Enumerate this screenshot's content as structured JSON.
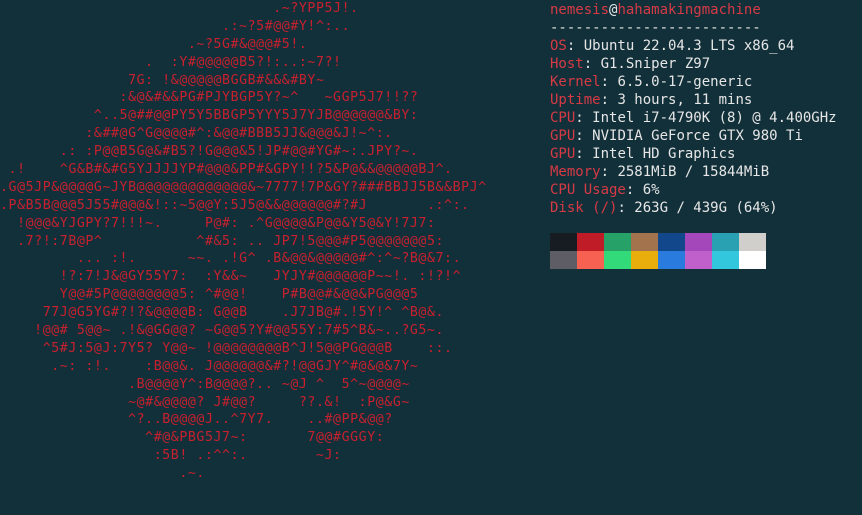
{
  "colors": {
    "background": "#12303a",
    "accent": "#c8202e",
    "text": "#e6e6e6"
  },
  "logo_lines": [
    "                                .~?YPP5J!.",
    "                          .:~?5#@@#Y!^:..",
    "                      .~?5G#&@@@#5!.",
    "                 .  :Y#@@@@@B5?!:..:~7?!",
    "               7G: !&@@@@@BGGB#&&&#BY~",
    "              :&@&#&&PG#PJYBGP5Y?~^   ~GGP5J7!!??",
    "           ^..5@##@@PY5Y5BBGP5YYY5J7YJB@@@@@@&BY:",
    "          :&##@G^G@@@@#^:&@@#BBB5JJ&@@@&J!~^:.",
    "       .: :P@@B5G@&#B5?!G@@@&5!JP#@@#YG#~:.JPY?~.",
    " .!    ^G&B#&#G5YJJJJYP#@@@&PP#&GPY!!?5&P@&&@@@@@BJ^.",
    ".G@5JP&@@@@G~JYB@@@@@@@@@@@@@&~7777!7P&GY?###BBJJ5B&&BPJ^",
    ".P&B5B@@@5J55#@@@&!::~5@@Y:5J5@&&@@@@@@#?#J       .:^:.",
    "  !@@@&YJGPY?7!!!~.     P@#: .^G@@@@&P@@&Y5@&Y!7J7:",
    "  .7?!:7B@P^           ^#&5: .. JP7!5@@@#P5@@@@@@@5:",
    "         ... :!.      ~~. .!G^ .B&@@&@@@@@#^:^~?B@&7:.",
    "       !?:7!J&@GY55Y7:  :Y&&~   JYJY#@@@@@@P~~!. :!?!^",
    "       Y@@#5P@@@@@@@@5: ^#@@!    P#B@@#&@@&PG@@@5",
    "     77J@G5YG#?!?&@@@@B: G@@B    .J7JB@#.!5Y!^ ^B@&.",
    "    !@@# 5@@~ .!&@GG@@? ~G@@5?Y#@@55Y:7#5^B&~..?G5~.",
    "     ^5#J:5@J:7Y5? Y@@~ !@@@@@@@@B^J!5@@PG@@@B    ::.",
    "      .~: :!.    :B@@&. J@@@@@@&#?!@@GJY^#@&@&7Y~",
    "               .B@@@@Y^:B@@@@?.. ~@J ^  5^~@@@@~",
    "               ~@#&@@@@? J#@@?     ??.&!  :P@&G~",
    "               ^?..B@@@@J..^7Y7.    ..#@PP&@@?",
    "                 ^#@&PBG5J7~:       7@@#GGGY:",
    "                  :5B! .:^^:.        ~J:",
    "                     .~."
  ],
  "system_info": {
    "username": "nemesis",
    "at": "@",
    "hostname": "hahamakingmachine",
    "separator": "-------------------------",
    "rows": [
      {
        "label": "OS",
        "value": "Ubuntu 22.04.3 LTS x86_64"
      },
      {
        "label": "Host",
        "value": "G1.Sniper Z97"
      },
      {
        "label": "Kernel",
        "value": "6.5.0-17-generic"
      },
      {
        "label": "Uptime",
        "value": "3 hours, 11 mins"
      },
      {
        "label": "CPU",
        "value": "Intel i7-4790K (8) @ 4.400GHz"
      },
      {
        "label": "GPU",
        "value": "NVIDIA GeForce GTX 980 Ti"
      },
      {
        "label": "GPU",
        "value": "Intel HD Graphics"
      },
      {
        "label": "Memory",
        "value": "2581MiB / 15844MiB"
      },
      {
        "label": "CPU Usage",
        "value": "6%"
      },
      {
        "label": "Disk (/)",
        "value": "263G / 439G (64%)"
      }
    ]
  },
  "palette": {
    "row1": [
      "#171b22",
      "#c01c28",
      "#26a269",
      "#a2734c",
      "#12488b",
      "#a347ba",
      "#2aa1b3",
      "#d0cfcc"
    ],
    "row2": [
      "#5e5c64",
      "#f66151",
      "#33da7a",
      "#e9ad0c",
      "#2a7bde",
      "#c061cb",
      "#33c7de",
      "#ffffff"
    ]
  }
}
